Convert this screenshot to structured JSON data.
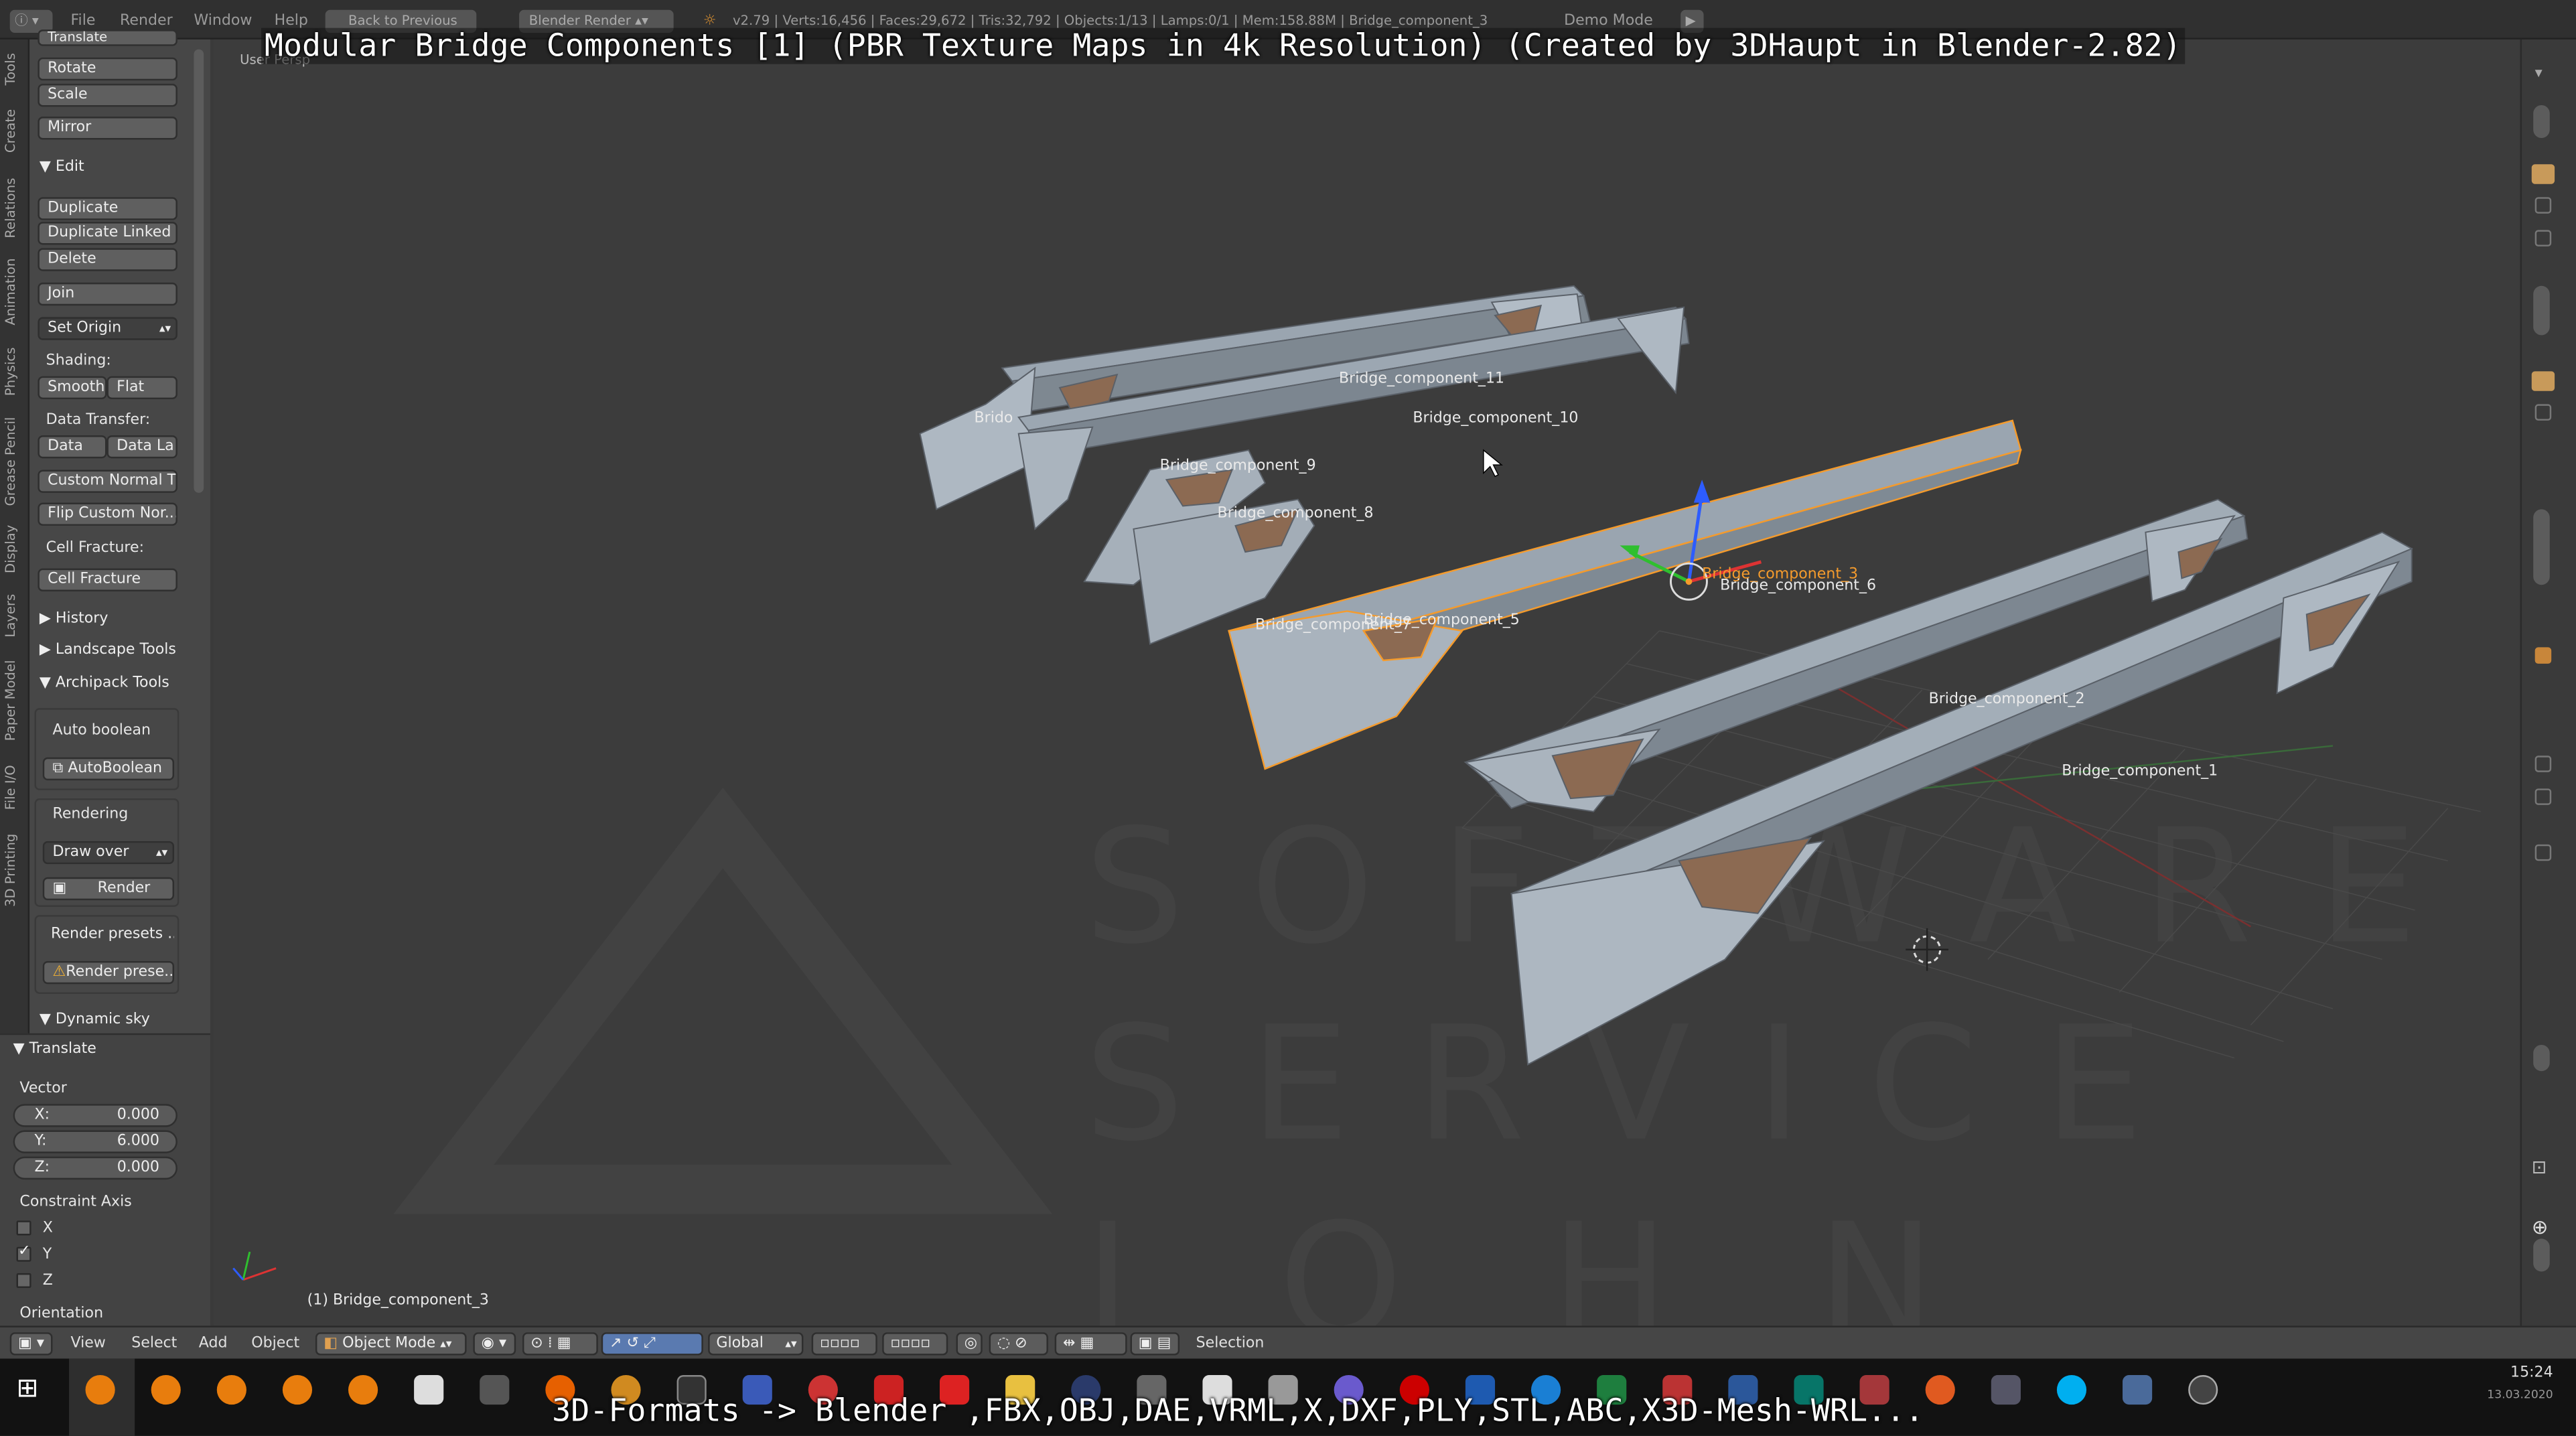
{
  "overlay": {
    "title": "Modular Bridge Components [1] (PBR Texture Maps in 4k Resolution) (Created by 3DHaupt in Blender-2.82)",
    "formats": "3D-Formats -> Blender ,FBX,OBJ,DAE,VRML,X,DXF,PLY,STL,ABC,X3D-Mesh-WRL..."
  },
  "topbar": {
    "menus": [
      "File",
      "Render",
      "Window",
      "Help"
    ],
    "back_button": "Back to Previous",
    "engine": "Blender Render",
    "stats": "v2.79 | Verts:16,456 | Faces:29,672 | Tris:32,792 | Objects:1/13 | Lamps:0/1 | Mem:158.88M | Bridge_component_3",
    "demo_mode": "Demo Mode"
  },
  "tool_tabs": [
    "Tools",
    "Create",
    "Relations",
    "Animation",
    "Physics",
    "Grease Pencil",
    "Display",
    "Layers",
    "Paper Model",
    "File I/O",
    "3D Printing"
  ],
  "panel": {
    "translate_cut": "Translate",
    "rotate": "Rotate",
    "scale": "Scale",
    "mirror": "Mirror",
    "edit_header": "Edit",
    "duplicate": "Duplicate",
    "duplicate_linked": "Duplicate Linked",
    "delete": "Delete",
    "join": "Join",
    "set_origin": "Set Origin",
    "shading_label": "Shading:",
    "smooth": "Smooth",
    "flat": "Flat",
    "data_transfer_label": "Data Transfer:",
    "data": "Data",
    "data_la": "Data La",
    "custom_normal": "Custom Normal T...",
    "flip_custom": "Flip Custom Nor...",
    "cell_fracture_label": "Cell Fracture:",
    "cell_fracture": "Cell Fracture",
    "history": "History",
    "landscape_tools": "Landscape Tools",
    "archipack_tools": "Archipack Tools",
    "auto_boolean_label": "Auto boolean",
    "auto_boolean": "AutoBoolean",
    "rendering_label": "Rendering",
    "draw_over": "Draw over",
    "render": "Render",
    "render_presets": "Render presets ...",
    "render_prese": "Render prese...",
    "dynamic_sky": "Dynamic sky",
    "translate_header": "Translate",
    "vector_label": "Vector",
    "vector": [
      {
        "axis": "X:",
        "value": "0.000"
      },
      {
        "axis": "Y:",
        "value": "6.000"
      },
      {
        "axis": "Z:",
        "value": "0.000"
      }
    ],
    "constraint_label": "Constraint Axis",
    "constraint": [
      {
        "axis": "X",
        "checked": false
      },
      {
        "axis": "Y",
        "checked": true
      },
      {
        "axis": "Z",
        "checked": false
      }
    ],
    "orientation_label": "Orientation"
  },
  "viewport": {
    "view_name": "User Persp",
    "active_object": "(1) Bridge_component_3",
    "labels": [
      "Bridge_component_11",
      "Bridge_component_10",
      "Brido",
      "Bridge_component_9",
      "Bridge_component_8",
      "Bridge_component_3",
      "Bridge_component_6",
      "Bridge_component_7",
      "Bridge_component_5",
      "Bridge_component_2",
      "Bridge_component_1"
    ],
    "watermark": [
      "SOFTWARE",
      "SERVICE",
      "JOHN"
    ]
  },
  "header3d": {
    "view": "View",
    "select": "Select",
    "add": "Add",
    "object": "Object",
    "mode": "Object Mode",
    "orientation": "Global",
    "selection": "Selection"
  },
  "taskbar": {
    "time": "15:24",
    "date": "13.03.2020"
  },
  "colors": {
    "accent_selected": "#f59b2c",
    "viewport_bg": "#3c3c3c",
    "panel_bg": "#474747"
  }
}
